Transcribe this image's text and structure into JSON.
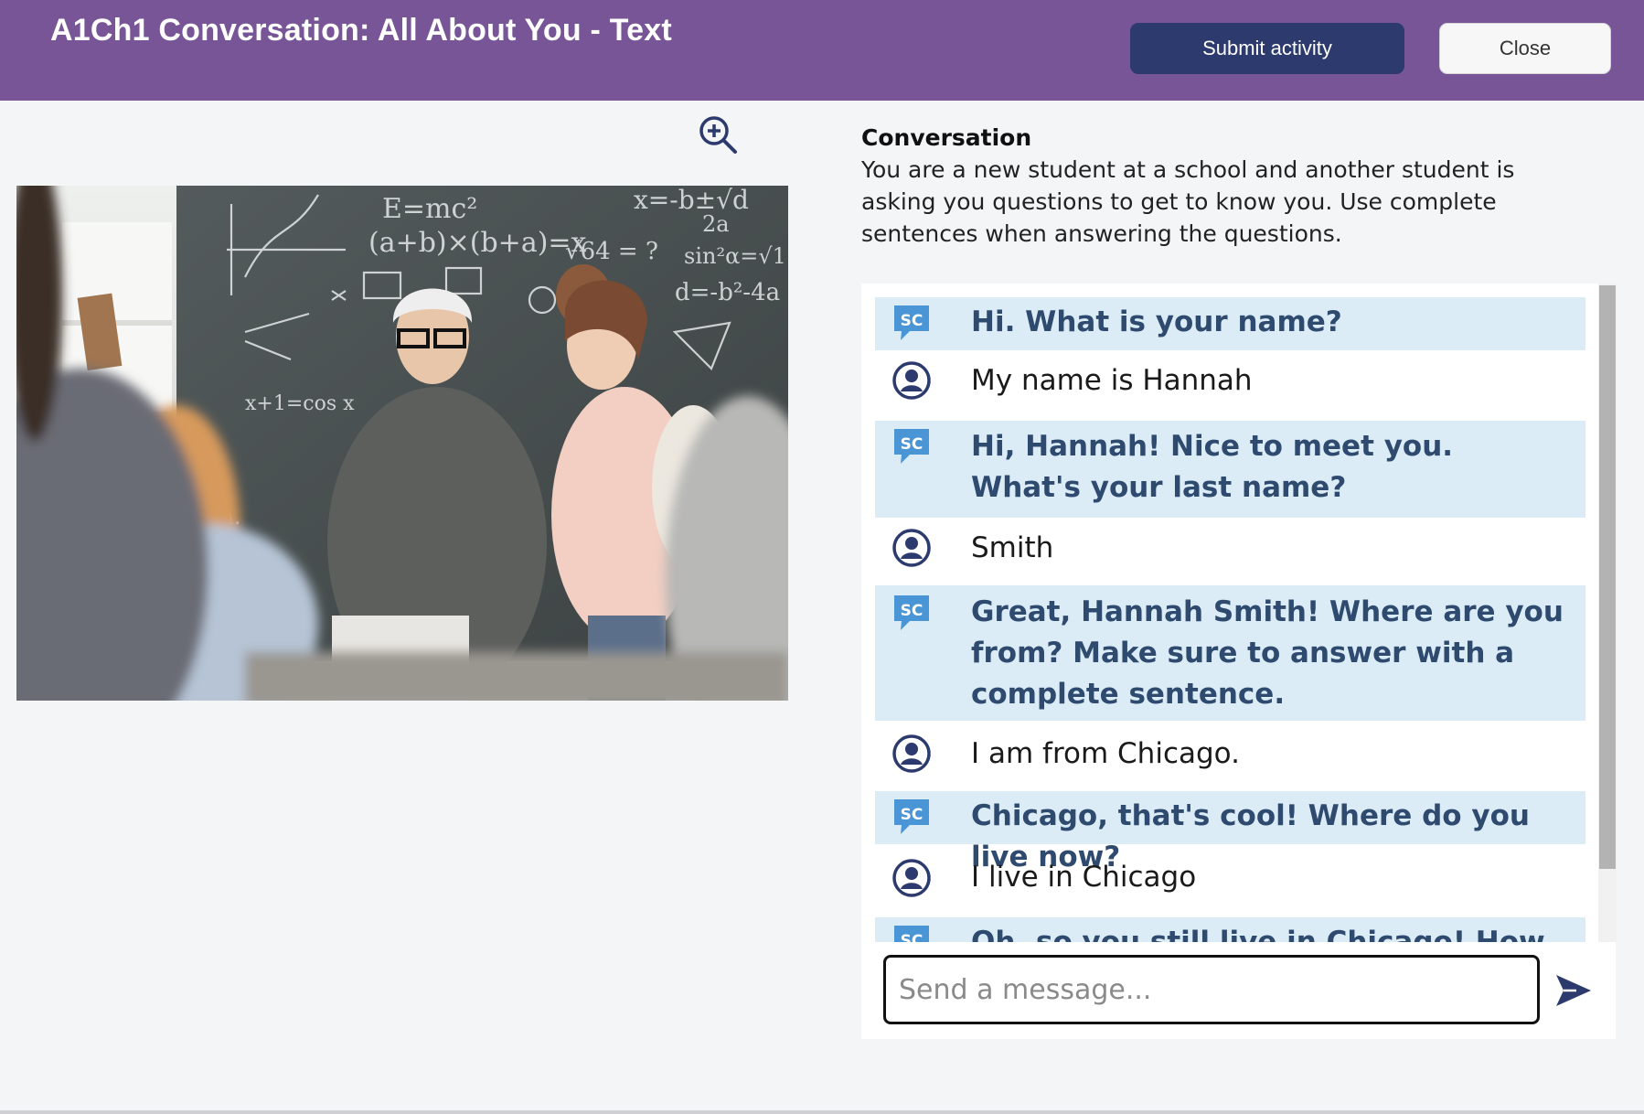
{
  "header": {
    "title": "A1Ch1 Conversation: All About You - Text",
    "submit_label": "Submit activity",
    "close_label": "Close"
  },
  "colors": {
    "header_bg": "#775596",
    "submit_bg": "#2c3a6e",
    "bot_bubble_bg": "#dbecf7",
    "bot_text": "#2e4a6e",
    "icon_blue": "#4a95d6",
    "user_icon": "#2c3a6e"
  },
  "icons": {
    "zoom": "zoom-in-icon",
    "bot": "sc-chat-bubble-icon",
    "user": "user-circle-icon",
    "send": "send-arrow-icon"
  },
  "image": {
    "description": "teacher-and-student-in-classroom-photo"
  },
  "conversation": {
    "heading": "Conversation",
    "description": "You are a new student at a school and another student is asking you questions to get to know you. Use complete sentences when answering the questions."
  },
  "messages": [
    {
      "role": "bot",
      "text": "Hi. What is your name?"
    },
    {
      "role": "user",
      "text": "My name is Hannah"
    },
    {
      "role": "bot",
      "text": "Hi, Hannah! Nice to meet you. What's your last name?"
    },
    {
      "role": "user",
      "text": "Smith"
    },
    {
      "role": "bot",
      "text": "Great, Hannah Smith! Where are you from? Make sure to answer with a complete sentence."
    },
    {
      "role": "user",
      "text": "I am from Chicago."
    },
    {
      "role": "bot",
      "text": "Chicago, that's cool! Where do you live now?"
    },
    {
      "role": "user",
      "text": "I live in Chicago"
    },
    {
      "role": "bot",
      "text": "Oh, so you still live in Chicago! How old are"
    }
  ],
  "composer": {
    "placeholder": "Send a message...",
    "value": ""
  }
}
